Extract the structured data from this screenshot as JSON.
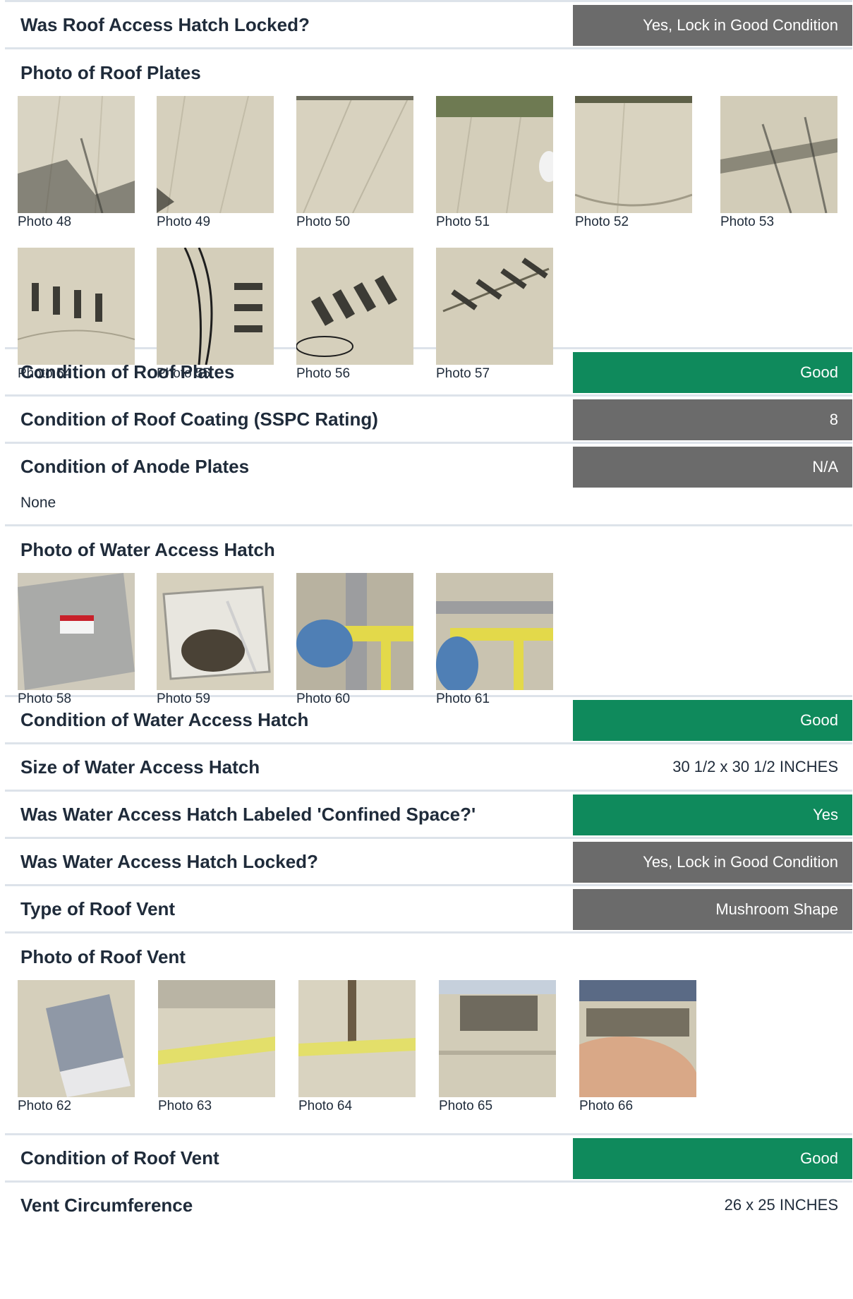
{
  "rows": {
    "roof_hatch_locked": {
      "label": "Was Roof Access Hatch Locked?",
      "value": "Yes, Lock in Good Condition"
    },
    "roof_plates_condition": {
      "label": "Condition of Roof Plates",
      "value": "Good"
    },
    "roof_coating": {
      "label": "Condition of Roof Coating (SSPC Rating)",
      "value": "8"
    },
    "anode_plates": {
      "label": "Condition of Anode Plates",
      "value": "N/A",
      "note": "None"
    },
    "water_hatch_condition": {
      "label": "Condition of Water Access Hatch",
      "value": "Good"
    },
    "water_hatch_size": {
      "label": "Size of Water Access Hatch",
      "value": "30 1/2 x 30 1/2 INCHES"
    },
    "water_hatch_confined": {
      "label": "Was Water Access Hatch Labeled 'Confined Space?'",
      "value": "Yes"
    },
    "water_hatch_locked": {
      "label": "Was Water Access Hatch Locked?",
      "value": "Yes, Lock in Good Condition"
    },
    "roof_vent_type": {
      "label": "Type of Roof Vent",
      "value": "Mushroom Shape"
    },
    "roof_vent_condition": {
      "label": "Condition of Roof Vent",
      "value": "Good"
    },
    "vent_circumference": {
      "label": "Vent Circumference",
      "value": "26 x 25 INCHES"
    }
  },
  "sections": {
    "roof_plates": {
      "title": "Photo of Roof Plates",
      "photos": [
        "Photo 48",
        "Photo 49",
        "Photo 50",
        "Photo 51",
        "Photo 52",
        "Photo 53",
        "Photo 54",
        "Photo 55",
        "Photo 56",
        "Photo 57"
      ]
    },
    "water_hatch": {
      "title": "Photo of Water Access Hatch",
      "photos": [
        "Photo 58",
        "Photo 59",
        "Photo 60",
        "Photo 61"
      ]
    },
    "roof_vent": {
      "title": "Photo of Roof Vent",
      "photos": [
        "Photo 62",
        "Photo 63",
        "Photo 64",
        "Photo 65",
        "Photo 66"
      ]
    }
  },
  "colors": {
    "gray_pill": "#6b6b6b",
    "green_pill": "#0f8a5c",
    "divider": "#dde3ea",
    "text": "#1f2b3a"
  }
}
